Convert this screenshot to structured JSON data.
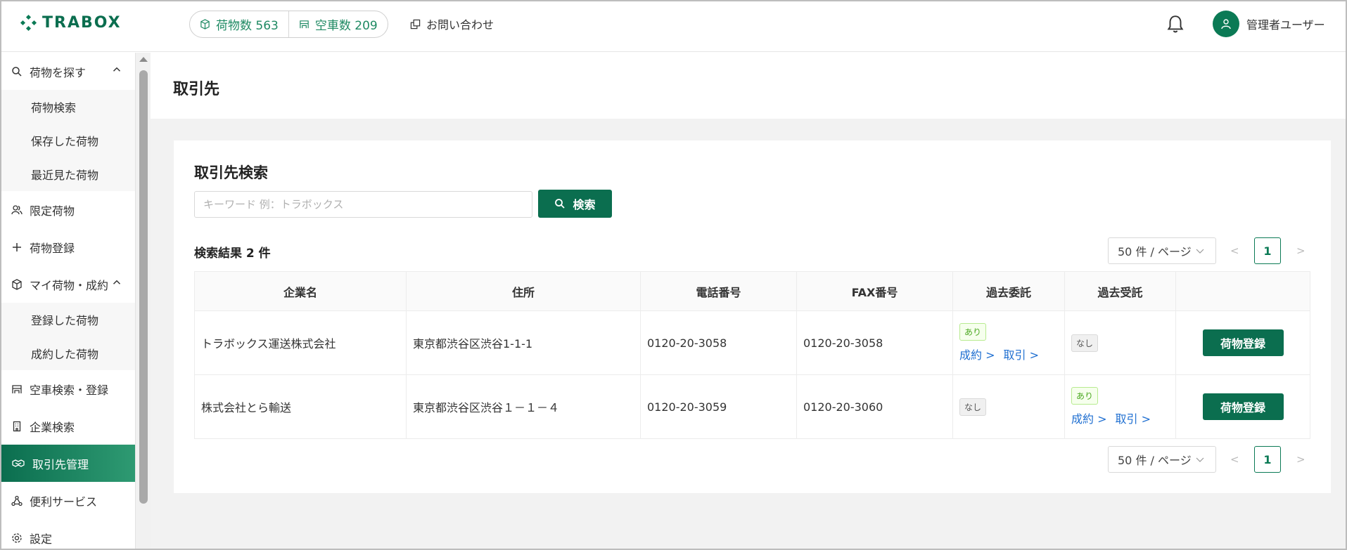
{
  "header": {
    "logo": "TRABOX",
    "cargo_count": "荷物数 563",
    "truck_count": "空車数 209",
    "contact": "お問い合わせ",
    "user_name": "管理者ユーザー"
  },
  "sidebar": {
    "search_cargo": "荷物を探す",
    "search_sub": [
      "荷物検索",
      "保存した荷物",
      "最近見た荷物"
    ],
    "limited_cargo": "限定荷物",
    "cargo_register": "荷物登録",
    "my_cargo": "マイ荷物・成約",
    "my_sub": [
      "登録した荷物",
      "成約した荷物"
    ],
    "truck": "空車検索・登録",
    "company_search": "企業検索",
    "partners": "取引先管理",
    "services": "便利サービス",
    "settings": "設定"
  },
  "page": {
    "title": "取引先",
    "card_title": "取引先検索",
    "search_placeholder": "キーワード 例：トラボックス",
    "search_button": "検索",
    "result_count": "検索結果 2 件",
    "page_size": "50 件 / ページ",
    "prev": "<",
    "next": ">",
    "current_page": "1"
  },
  "table": {
    "headers": [
      "企業名",
      "住所",
      "電話番号",
      "FAX番号",
      "過去委託",
      "過去受託",
      ""
    ],
    "rows": [
      {
        "company": "トラボックス運送株式会社",
        "address": "東京都渋谷区渋谷1-1-1",
        "phone": "0120-20-3058",
        "fax": "0120-20-3058",
        "consign_tag": "あり",
        "consign_link1": "成約 >",
        "consign_link2": "取引 >",
        "accept_tag": "なし",
        "button": "荷物登録"
      },
      {
        "company": "株式会社とら輸送",
        "address": "東京都渋谷区渋谷１－１－４",
        "phone": "0120-20-3059",
        "fax": "0120-20-3060",
        "consign_tag": "なし",
        "accept_tag": "あり",
        "accept_link1": "成約 >",
        "accept_link2": "取引 >",
        "button": "荷物登録"
      }
    ]
  },
  "colors": {
    "brand": "#0b6e4f",
    "link": "#1f6fd1"
  }
}
